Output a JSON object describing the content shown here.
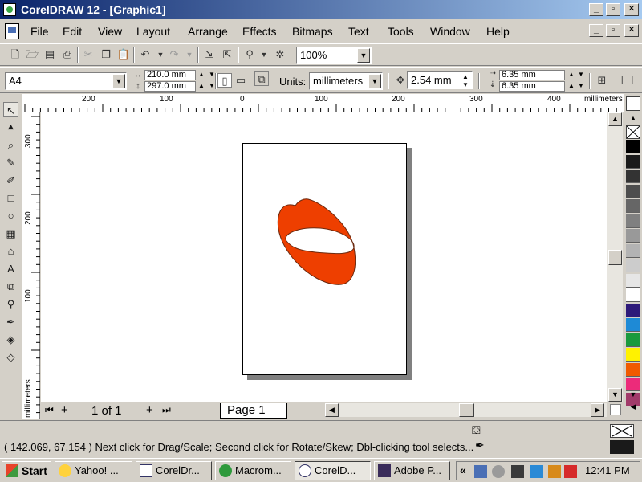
{
  "window": {
    "title": "CorelDRAW 12 - [Graphic1]",
    "min_glyph": "_",
    "max_glyph": "▫",
    "close_glyph": "✕"
  },
  "menu": {
    "items": [
      "File",
      "Edit",
      "View",
      "Layout",
      "Arrange",
      "Effects",
      "Bitmaps",
      "Text",
      "Tools",
      "Window",
      "Help"
    ]
  },
  "standard_toolbar": {
    "zoom_value": "100%"
  },
  "property_bar": {
    "paper_size": "A4",
    "width": "210.0 mm",
    "height": "297.0 mm",
    "units_label": "Units:",
    "units_value": "millimeters",
    "nudge": "2.54 mm",
    "dup_x": "6.35 mm",
    "dup_y": "6.35 mm"
  },
  "rulers": {
    "h_labels": [
      "200",
      "100",
      "0",
      "100",
      "200",
      "300",
      "400"
    ],
    "h_unit": "millimeters",
    "v_labels": [
      "300",
      "200",
      "100"
    ],
    "v_unit": "millimeters"
  },
  "page_navigator": {
    "counter": "1 of 1",
    "tab": "Page 1"
  },
  "status": {
    "text": "( 142.069, 67.154 ) Next click for Drag/Scale; Second click for Rotate/Skew; Dbl-clicking tool selects..."
  },
  "colors": {
    "shape_fill": "#ee3f00",
    "shape_stroke": "#6b2a10",
    "palette": [
      "#000000",
      "#1a1a1a",
      "#333333",
      "#4d4d4d",
      "#666666",
      "#808080",
      "#999999",
      "#b3b3b3",
      "#cccccc",
      "#e6e6e6",
      "#ffffff",
      "#2e1a7a",
      "#1e8ad6",
      "#1a9a3e",
      "#fff200",
      "#f05a00",
      "#ec2b7a",
      "#a13b6a"
    ]
  },
  "taskbar": {
    "start": "Start",
    "items": [
      "Yahoo! ...",
      "CorelDr...",
      "Macrom...",
      "CorelD...",
      "Adobe P..."
    ],
    "chevron": "«",
    "clock": "12:41 PM"
  }
}
